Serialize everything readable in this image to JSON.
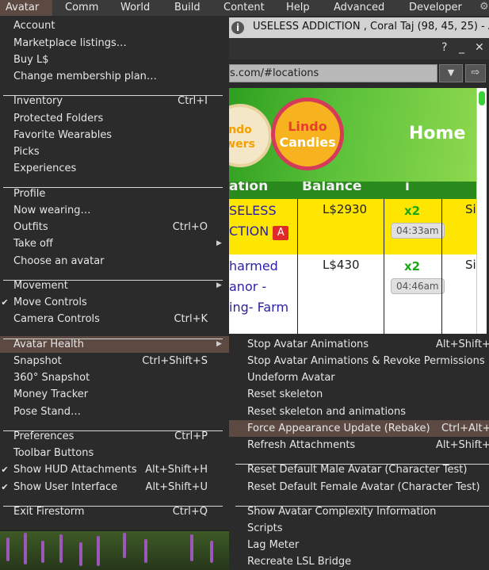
{
  "menubar": {
    "items": [
      "Avatar",
      "Comm",
      "World",
      "Build",
      "Content",
      "Help",
      "Advanced",
      "Developer"
    ],
    "active_index": 0
  },
  "browser": {
    "title": "USELESS ADDICTION , Coral Taj (98, 45, 25) - A",
    "controls": [
      "?",
      "_",
      "✕"
    ],
    "url": "s.com/#locations",
    "page": {
      "logo1": [
        "ndo",
        "wers"
      ],
      "logo2": [
        "Lindo",
        "Candies"
      ],
      "home": "Home",
      "headers": [
        "ation",
        "Balance",
        "i"
      ],
      "rows": [
        {
          "name": [
            "SELESS",
            "CTION"
          ],
          "badge": "A",
          "balance": "L$2930",
          "mult": "x2",
          "time": "04:33am",
          "extra": "Si"
        },
        {
          "name": [
            "harmed",
            "anor -",
            "ing- Farm"
          ],
          "balance": "L$430",
          "mult": "x2",
          "time": "04:46am",
          "extra": "Si"
        }
      ]
    }
  },
  "avatar_menu": {
    "items": [
      {
        "label": "Account",
        "shortcut": "",
        "check": false,
        "submenu": false
      },
      {
        "label": "Marketplace listings…",
        "shortcut": "",
        "check": false,
        "submenu": false
      },
      {
        "label": "Buy L$",
        "shortcut": "",
        "check": false,
        "submenu": false
      },
      {
        "label": "Change membership plan…",
        "shortcut": "",
        "check": false,
        "submenu": false
      },
      {
        "label": "Inventory",
        "shortcut": "Ctrl+I",
        "check": false,
        "submenu": false
      },
      {
        "label": "Protected Folders",
        "shortcut": "",
        "check": false,
        "submenu": false
      },
      {
        "label": "Favorite Wearables",
        "shortcut": "",
        "check": false,
        "submenu": false
      },
      {
        "label": "Picks",
        "shortcut": "",
        "check": false,
        "submenu": false
      },
      {
        "label": "Experiences",
        "shortcut": "",
        "check": false,
        "submenu": false
      },
      {
        "label": "Profile",
        "shortcut": "",
        "check": false,
        "submenu": false
      },
      {
        "label": "Now wearing…",
        "shortcut": "",
        "check": false,
        "submenu": false
      },
      {
        "label": "Outfits",
        "shortcut": "Ctrl+O",
        "check": false,
        "submenu": false
      },
      {
        "label": "Take off",
        "shortcut": "",
        "check": false,
        "submenu": true
      },
      {
        "label": "Choose an avatar",
        "shortcut": "",
        "check": false,
        "submenu": false
      },
      {
        "label": "Movement",
        "shortcut": "",
        "check": false,
        "submenu": true
      },
      {
        "label": "Move Controls",
        "shortcut": "",
        "check": true,
        "submenu": false
      },
      {
        "label": "Camera Controls",
        "shortcut": "Ctrl+K",
        "check": false,
        "submenu": false
      },
      {
        "label": "Avatar Health",
        "shortcut": "",
        "check": false,
        "submenu": true,
        "highlighted": true
      },
      {
        "label": "Snapshot",
        "shortcut": "Ctrl+Shift+S",
        "check": false,
        "submenu": false
      },
      {
        "label": "360° Snapshot",
        "shortcut": "",
        "check": false,
        "submenu": false
      },
      {
        "label": "Money Tracker",
        "shortcut": "",
        "check": false,
        "submenu": false
      },
      {
        "label": "Pose Stand…",
        "shortcut": "",
        "check": false,
        "submenu": false
      },
      {
        "label": "Preferences",
        "shortcut": "Ctrl+P",
        "check": false,
        "submenu": false
      },
      {
        "label": "Toolbar Buttons",
        "shortcut": "",
        "check": false,
        "submenu": false
      },
      {
        "label": "Show HUD Attachments",
        "shortcut": "Alt+Shift+H",
        "check": true,
        "submenu": false
      },
      {
        "label": "Show User Interface",
        "shortcut": "Alt+Shift+U",
        "check": true,
        "submenu": false
      },
      {
        "label": "Exit Firestorm",
        "shortcut": "Ctrl+Q",
        "check": false,
        "submenu": false
      }
    ]
  },
  "health_submenu": {
    "items": [
      {
        "label": "Stop Avatar Animations",
        "shortcut": "Alt+Shift+A"
      },
      {
        "label": "Stop Avatar Animations & Revoke Permissions",
        "shortcut": ""
      },
      {
        "label": "Undeform Avatar",
        "shortcut": ""
      },
      {
        "label": "Reset skeleton",
        "shortcut": ""
      },
      {
        "label": "Reset skeleton and animations",
        "shortcut": ""
      },
      {
        "label": "Force Appearance Update (Rebake)",
        "shortcut": "Ctrl+Alt+R",
        "highlighted": true
      },
      {
        "label": "Refresh Attachments",
        "shortcut": "Alt+Shift+R"
      },
      {
        "label": "Reset Default Male Avatar (Character Test)",
        "shortcut": ""
      },
      {
        "label": "Reset Default Female Avatar (Character Test)",
        "shortcut": ""
      },
      {
        "label": "Show Avatar Complexity Information",
        "shortcut": ""
      },
      {
        "label": "Scripts",
        "shortcut": ""
      },
      {
        "label": "Lag Meter",
        "shortcut": ""
      },
      {
        "label": "Recreate LSL Bridge",
        "shortcut": ""
      }
    ]
  },
  "colors": {
    "highlight": "#5c4a42",
    "menu_bg": "#2b2b2b",
    "menubar_bg": "#3a3a3a"
  }
}
